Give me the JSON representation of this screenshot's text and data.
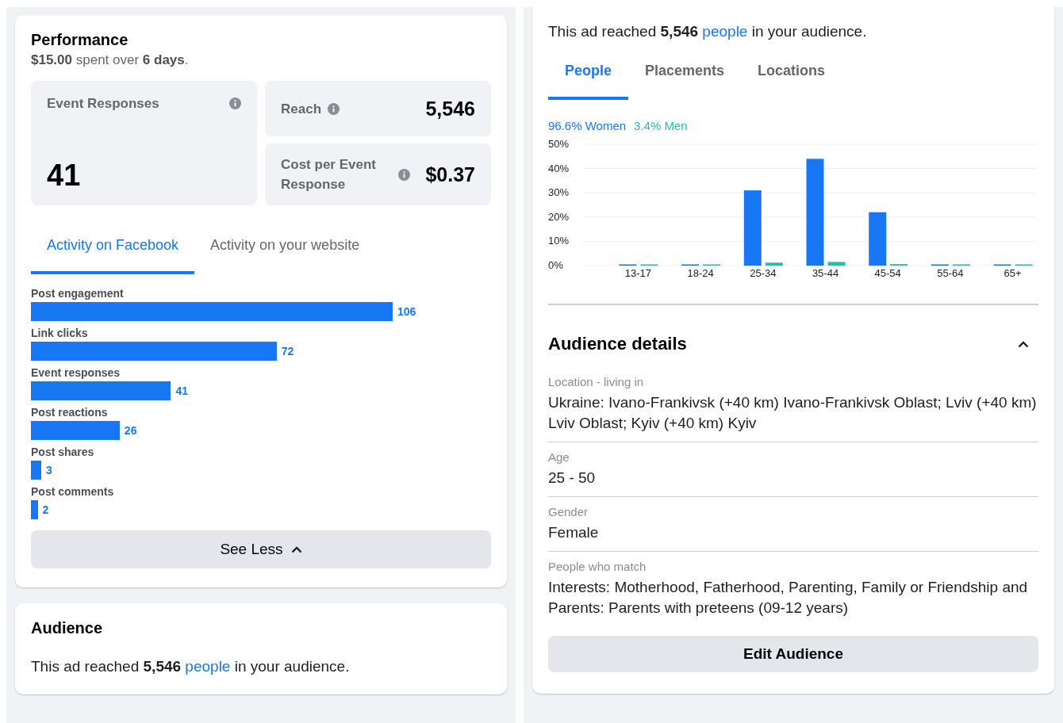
{
  "performance": {
    "title": "Performance",
    "summary": "**$15.00** spent over **6 days**.",
    "metrics": [
      {
        "label": "Event Responses",
        "value": "41",
        "kind": "large"
      },
      {
        "label": "Reach",
        "value": "5,546",
        "kind": "small"
      },
      {
        "label": "Cost per Event Response",
        "value": "$0.37",
        "kind": "small"
      }
    ],
    "tabs": [
      {
        "label": "Activity on Facebook",
        "selected": true
      },
      {
        "label": "Activity on your website",
        "selected": false
      }
    ],
    "activity": [
      {
        "label": "Post engagement",
        "value": "106"
      },
      {
        "label": "Link clicks",
        "value": "72"
      },
      {
        "label": "Event responses",
        "value": "41"
      },
      {
        "label": "Post reactions",
        "value": "26"
      },
      {
        "label": "Post shares",
        "value": "3"
      },
      {
        "label": "Post comments",
        "value": "2"
      }
    ],
    "see_less": "See Less"
  },
  "audience_card": {
    "title": "Audience",
    "reach": {
      "before": "This ad reached **5,546**",
      "link": "people",
      "after": "in your audience."
    }
  },
  "audience": {
    "reach": {
      "before": "This ad reached **5,546**",
      "link": "people",
      "after": "in your audience."
    },
    "tabs": [
      {
        "label": "People",
        "selected": true
      },
      {
        "label": "Placements",
        "selected": false
      },
      {
        "label": "Locations",
        "selected": false
      }
    ],
    "legend": [
      {
        "share": "96.6%"
      },
      {
        "share": "3.4%"
      }
    ],
    "chart_data": {
      "type": "bar",
      "grid": true,
      "categories": [
        "13-17",
        "18-24",
        "25-34",
        "35-44",
        "45-54",
        "55-64",
        "65+"
      ],
      "series": [
        {
          "name": "Women",
          "color": "#1877f2",
          "values": [
            0.3,
            0.3,
            31,
            44,
            22,
            0.3,
            0.3
          ]
        },
        {
          "name": "Men",
          "color": "#2abba7",
          "values": [
            0.3,
            0.3,
            1.2,
            1.5,
            0.6,
            0.3,
            0.3
          ]
        }
      ],
      "ylim": [
        0,
        50
      ],
      "yticks": [
        {
          "value": 0,
          "label": "0%"
        },
        {
          "value": 10,
          "label": "10%"
        },
        {
          "value": 20,
          "label": "20%"
        },
        {
          "value": 30,
          "label": "30%"
        },
        {
          "value": 40,
          "label": "40%"
        },
        {
          "value": 50,
          "label": "50%"
        }
      ]
    },
    "details_title": "Audience details",
    "details_expanded": true,
    "details": [
      {
        "label": "Location - living in",
        "value": "Ukraine: Ivano-Frankivsk (+40 km) Ivano-Frankivsk Oblast; Lviv (+40 km) Lviv Oblast; Kyiv (+40 km) Kyiv"
      },
      {
        "label": "Age",
        "value": "25 - 50"
      },
      {
        "label": "Gender",
        "value": "Female"
      },
      {
        "label": "People who match",
        "value": "Interests: Motherhood, Fatherhood, Parenting, Family or Friendship and Parents: Parents with preteens (09-12 years)"
      }
    ],
    "edit_button": "Edit Audience"
  }
}
